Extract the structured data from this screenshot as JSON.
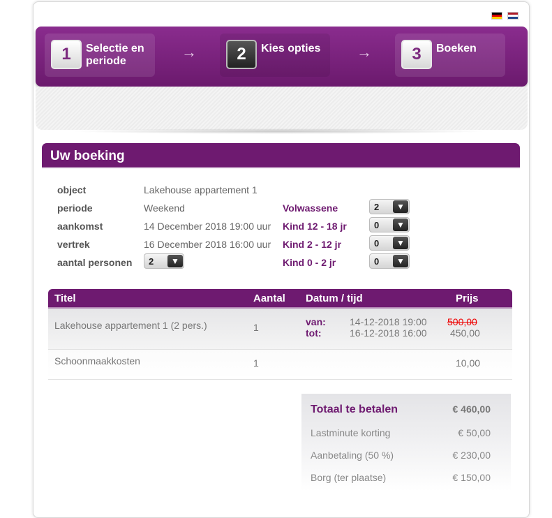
{
  "flags": [
    {
      "name": "german-flag-icon",
      "colors": [
        "#000000",
        "#dd0000",
        "#ffce00"
      ]
    },
    {
      "name": "dutch-flag-icon",
      "colors": [
        "#ae1c28",
        "#ffffff",
        "#21468b"
      ]
    }
  ],
  "steps": [
    {
      "number": "1",
      "label": "Selectie en periode",
      "active": false
    },
    {
      "number": "2",
      "label": "Kies opties",
      "active": true
    },
    {
      "number": "3",
      "label": "Boeken",
      "active": false
    }
  ],
  "arrow_glyph": "→",
  "booking": {
    "title": "Uw boeking",
    "object_label": "object",
    "object_value": "Lakehouse appartement 1",
    "periode_label": "periode",
    "periode_value": "Weekend",
    "aankomst_label": "aankomst",
    "aankomst_value": "14 December 2018 19:00 uur",
    "vertrek_label": "vertrek",
    "vertrek_value": "16 December 2018 16:00 uur",
    "personen_label": "aantal personen",
    "personen_value": "2",
    "volwassenen_label": "Volwassene",
    "volwassenen_value": "2",
    "kind12_label": "Kind 12 - 18 jr",
    "kind12_value": "0",
    "kind2_label": "Kind 2 - 12 jr",
    "kind2_value": "0",
    "kind0_label": "Kind 0 - 2 jr",
    "kind0_value": "0"
  },
  "table": {
    "headers": {
      "titel": "Titel",
      "aantal": "Aantal",
      "datum": "Datum / tijd",
      "prijs": "Prijs"
    },
    "rows": [
      {
        "titel": "Lakehouse appartement 1 (2 pers.)",
        "aantal": "1",
        "van_label": "van:",
        "van_value": "14-12-2018 19:00",
        "tot_label": "tot:",
        "tot_value": "16-12-2018 16:00",
        "old_price": "500,00",
        "price": "450,00"
      },
      {
        "titel": "Schoonmaakkosten",
        "aantal": "1",
        "price": "10,00"
      }
    ]
  },
  "totals": {
    "total_label": "Totaal te betalen",
    "total_value": "€ 460,00",
    "korting_label": "Lastminute korting",
    "korting_value": "€ 50,00",
    "aanbetaling_label": "Aanbetaling (50 %)",
    "aanbetaling_value": "€ 230,00",
    "borg_label": "Borg (ter plaatse)",
    "borg_value": "€ 150,00"
  },
  "dropdown_glyph": "▼",
  "colors": {
    "brand": "#6e1a70",
    "strike": "#e00000"
  }
}
